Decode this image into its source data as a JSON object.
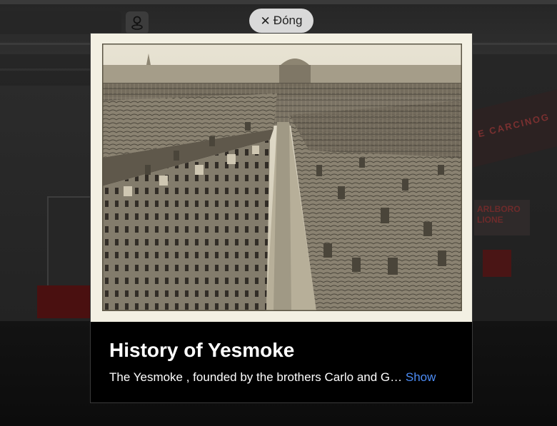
{
  "close_button": {
    "label": "Đóng",
    "icon": "close-icon"
  },
  "toolbar": {
    "location_icon": "location-pin-icon"
  },
  "card": {
    "title": "History of Yesmoke",
    "description": "The Yesmoke , founded by the brothers Carlo and G…",
    "show_label": "Show",
    "show_color": "#4c8cf5",
    "image_icon": "historic-city-photo"
  },
  "background": {
    "sign_text": "E CARCINOG",
    "poster_text_1": "ARLBORO",
    "poster_text_2": "LIONE"
  }
}
